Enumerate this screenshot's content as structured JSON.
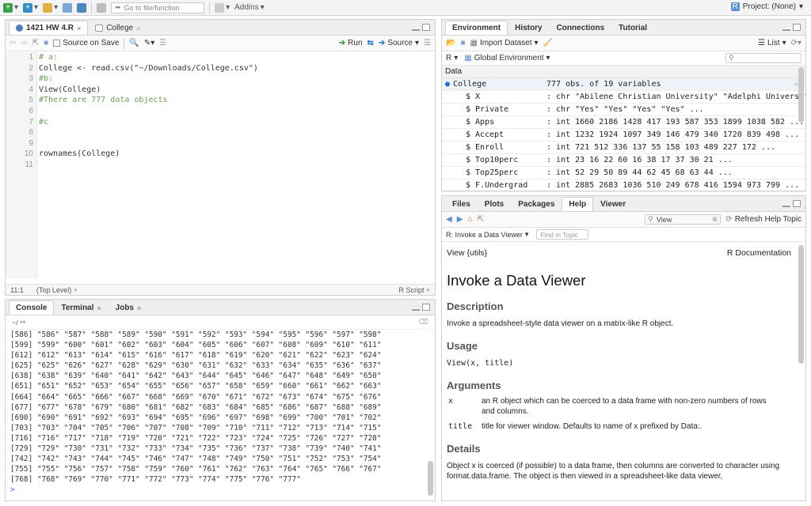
{
  "toolbar": {
    "goto_placeholder": "Go to file/function",
    "addins": "Addins",
    "project": "Project: (None)"
  },
  "editor": {
    "tabs": [
      {
        "label": "1421 HW 4.R"
      },
      {
        "label": "College"
      }
    ],
    "source_on_save": "Source on Save",
    "run": "Run",
    "source": "Source",
    "line_numbers": [
      "1",
      "2",
      "3",
      "4",
      "5",
      "6",
      "7",
      "8",
      "9",
      "10",
      "11"
    ],
    "lines": [
      {
        "t": "# a:",
        "k": "cm"
      },
      {
        "t": "College <- read.csv(\"~/Downloads/College.csv\")",
        "k": "code"
      },
      {
        "t": "#b:",
        "k": "cm"
      },
      {
        "t": "View(College)",
        "k": "code"
      },
      {
        "t": "#There are 777 data objects",
        "k": "cm"
      },
      {
        "t": "",
        "k": "code"
      },
      {
        "t": "#c",
        "k": "cm"
      },
      {
        "t": "",
        "k": "code"
      },
      {
        "t": "",
        "k": "code"
      },
      {
        "t": "rownames(College)",
        "k": "code"
      },
      {
        "t": "",
        "k": "code"
      }
    ],
    "status_pos": "11:1",
    "status_scope": "(Top Level) ÷",
    "status_type": "R Script ÷"
  },
  "console": {
    "tabs": [
      {
        "label": "Console"
      },
      {
        "label": "Terminal"
      },
      {
        "label": "Jobs"
      }
    ],
    "path": "~/",
    "rows": [
      "[586] \"586\" \"587\" \"588\" \"589\" \"590\" \"591\" \"592\" \"593\" \"594\" \"595\" \"596\" \"597\" \"598\"",
      "[599] \"599\" \"600\" \"601\" \"602\" \"603\" \"604\" \"605\" \"606\" \"607\" \"608\" \"609\" \"610\" \"611\"",
      "[612] \"612\" \"613\" \"614\" \"615\" \"616\" \"617\" \"618\" \"619\" \"620\" \"621\" \"622\" \"623\" \"624\"",
      "[625] \"625\" \"626\" \"627\" \"628\" \"629\" \"630\" \"631\" \"632\" \"633\" \"634\" \"635\" \"636\" \"637\"",
      "[638] \"638\" \"639\" \"640\" \"641\" \"642\" \"643\" \"644\" \"645\" \"646\" \"647\" \"648\" \"649\" \"650\"",
      "[651] \"651\" \"652\" \"653\" \"654\" \"655\" \"656\" \"657\" \"658\" \"659\" \"660\" \"661\" \"662\" \"663\"",
      "[664] \"664\" \"665\" \"666\" \"667\" \"668\" \"669\" \"670\" \"671\" \"672\" \"673\" \"674\" \"675\" \"676\"",
      "[677] \"677\" \"678\" \"679\" \"680\" \"681\" \"682\" \"683\" \"684\" \"685\" \"686\" \"687\" \"688\" \"689\"",
      "[690] \"690\" \"691\" \"692\" \"693\" \"694\" \"695\" \"696\" \"697\" \"698\" \"699\" \"700\" \"701\" \"702\"",
      "[703] \"703\" \"704\" \"705\" \"706\" \"707\" \"708\" \"709\" \"710\" \"711\" \"712\" \"713\" \"714\" \"715\"",
      "[716] \"716\" \"717\" \"718\" \"719\" \"720\" \"721\" \"722\" \"723\" \"724\" \"725\" \"726\" \"727\" \"728\"",
      "[729] \"729\" \"730\" \"731\" \"732\" \"733\" \"734\" \"735\" \"736\" \"737\" \"738\" \"739\" \"740\" \"741\"",
      "[742] \"742\" \"743\" \"744\" \"745\" \"746\" \"747\" \"748\" \"749\" \"750\" \"751\" \"752\" \"753\" \"754\"",
      "[755] \"755\" \"756\" \"757\" \"758\" \"759\" \"760\" \"761\" \"762\" \"763\" \"764\" \"765\" \"766\" \"767\"",
      "[768] \"768\" \"769\" \"770\" \"771\" \"772\" \"773\" \"774\" \"775\" \"776\" \"777\""
    ],
    "prompt": ">"
  },
  "env": {
    "tabs": [
      {
        "label": "Environment"
      },
      {
        "label": "History"
      },
      {
        "label": "Connections"
      },
      {
        "label": "Tutorial"
      }
    ],
    "import": "Import Dataset",
    "list": "List",
    "lang": "R",
    "scope": "Global Environment",
    "data_header": "Data",
    "object": {
      "name": "College",
      "value": "777 obs. of 19 variables"
    },
    "vars": [
      {
        "n": "$ X",
        "v": ": chr  \"Abilene Christian University\" \"Adelphi University…"
      },
      {
        "n": "$ Private",
        "v": ": chr  \"Yes\" \"Yes\" \"Yes\" \"Yes\" ..."
      },
      {
        "n": "$ Apps",
        "v": ": int  1660 2186 1428 417 193 587 353 1899 1038 582 ..."
      },
      {
        "n": "$ Accept",
        "v": ": int  1232 1924 1097 349 146 479 340 1720 839 498 ..."
      },
      {
        "n": "$ Enroll",
        "v": ": int  721 512 336 137 55 158 103 489 227 172 ..."
      },
      {
        "n": "$ Top10perc",
        "v": ": int  23 16 22 60 16 38 17 37 30 21 ..."
      },
      {
        "n": "$ Top25perc",
        "v": ": int  52 29 50 89 44 62 45 68 63 44 ..."
      },
      {
        "n": "$ F.Undergrad",
        "v": ": int  2885 2683 1036 510 249 678 416 1594 973 799 ..."
      }
    ]
  },
  "help": {
    "tabs": [
      {
        "label": "Files"
      },
      {
        "label": "Plots"
      },
      {
        "label": "Packages"
      },
      {
        "label": "Help"
      },
      {
        "label": "Viewer"
      }
    ],
    "search_value": "View",
    "refresh": "Refresh Help Topic",
    "topic": "R: Invoke a Data Viewer",
    "find_placeholder": "Find in Topic",
    "pkg": "View {utils}",
    "doc": "R Documentation",
    "title": "Invoke a Data Viewer",
    "desc_h": "Description",
    "desc": "Invoke a spreadsheet-style data viewer on a matrix-like R object.",
    "usage_h": "Usage",
    "usage": "View(x, title)",
    "args_h": "Arguments",
    "args": [
      {
        "name": "x",
        "desc": "an R object which can be coerced to a data frame with non-zero numbers of rows and columns."
      },
      {
        "name": "title",
        "desc": "title for viewer window. Defaults to name of x prefixed by Data:."
      }
    ],
    "details_h": "Details",
    "details": "Object x is coerced (if possible) to a data frame, then columns are converted to character using format.data.frame. The object is then viewed in a spreadsheet-like data viewer,"
  }
}
